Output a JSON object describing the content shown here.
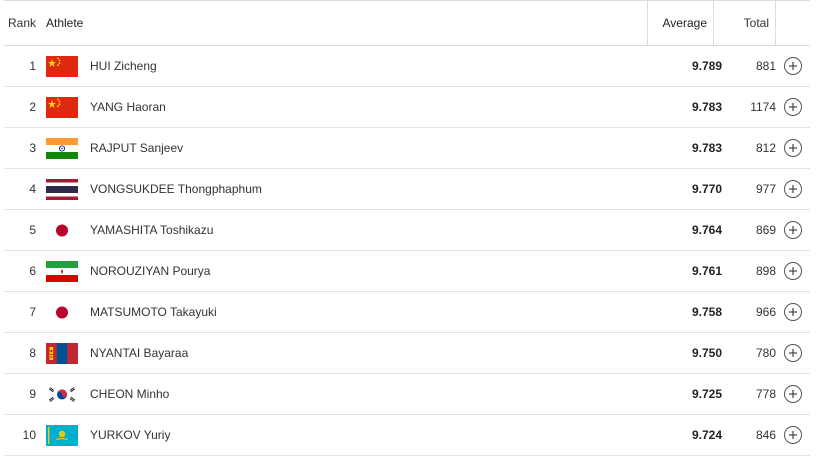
{
  "header": {
    "rank": "Rank",
    "athlete": "Athlete",
    "average": "Average",
    "total": "Total"
  },
  "rows": [
    {
      "rank": "1",
      "name": "HUI Zicheng",
      "flag": "china-flag-icon",
      "average": "9.789",
      "total": "881"
    },
    {
      "rank": "2",
      "name": "YANG Haoran",
      "flag": "china-flag-icon",
      "average": "9.783",
      "total": "1174"
    },
    {
      "rank": "3",
      "name": "RAJPUT Sanjeev",
      "flag": "india-flag-icon",
      "average": "9.783",
      "total": "812"
    },
    {
      "rank": "4",
      "name": "VONGSUKDEE Thongphaphum",
      "flag": "thailand-flag-icon",
      "average": "9.770",
      "total": "977"
    },
    {
      "rank": "5",
      "name": "YAMASHITA Toshikazu",
      "flag": "japan-flag-icon",
      "average": "9.764",
      "total": "869"
    },
    {
      "rank": "6",
      "name": "NOROUZIYAN Pourya",
      "flag": "iran-flag-icon",
      "average": "9.761",
      "total": "898"
    },
    {
      "rank": "7",
      "name": "MATSUMOTO Takayuki",
      "flag": "japan-flag-icon",
      "average": "9.758",
      "total": "966"
    },
    {
      "rank": "8",
      "name": "NYANTAI Bayaraa",
      "flag": "mongolia-flag-icon",
      "average": "9.750",
      "total": "780"
    },
    {
      "rank": "9",
      "name": "CHEON Minho",
      "flag": "korea-flag-icon",
      "average": "9.725",
      "total": "778"
    },
    {
      "rank": "10",
      "name": "YURKOV Yuriy",
      "flag": "kazakhstan-flag-icon",
      "average": "9.724",
      "total": "846"
    }
  ],
  "colors": {
    "china_red": "#de2910",
    "china_yellow": "#ffde00",
    "india_saffron": "#ff9933",
    "india_green": "#138808",
    "india_chakra": "#000080",
    "thai_red": "#a51931",
    "thai_blue": "#2d2a4a",
    "japan_red": "#bc002d",
    "iran_green": "#239f40",
    "iran_red": "#da0000",
    "mongolia_red": "#c4272f",
    "mongolia_blue": "#015197",
    "mongolia_yellow": "#f9cf02",
    "korea_red": "#cd2e3a",
    "korea_blue": "#0047a0",
    "kazakh_blue": "#00afca",
    "kazakh_yellow": "#fec50c"
  }
}
